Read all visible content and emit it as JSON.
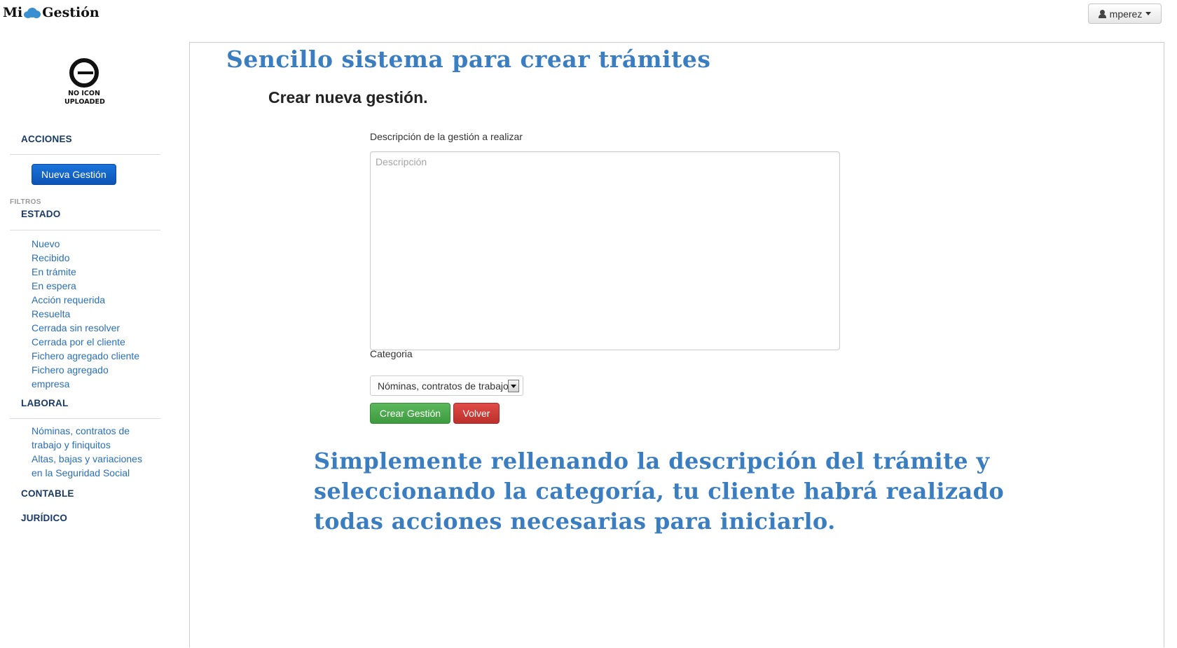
{
  "header": {
    "brand_left": "Mi",
    "brand_right": "Gestión",
    "user_label": "mperez"
  },
  "sidebar": {
    "logo_line1": "NO ICON",
    "logo_line2": "UPLOADED",
    "acciones_title": "ACCIONES",
    "nueva_gestion": "Nueva Gestión",
    "filtros_title": "FILTROS",
    "estado_title": "ESTADO",
    "estado_items": [
      "Nuevo",
      "Recibido",
      "En trámite",
      "En espera",
      "Acción requerida",
      "Resuelta",
      "Cerrada sin resolver",
      "Cerrada por el cliente",
      "Fichero agregado cliente",
      "Fichero agregado",
      "empresa"
    ],
    "laboral_title": "LABORAL",
    "laboral_items": [
      "Nóminas, contratos de",
      "trabajo y finiquitos",
      "Altas, bajas y variaciones",
      "en la Seguridad Social"
    ],
    "contable_title": "CONTABLE",
    "juridico_title": "JURÍDICO"
  },
  "main": {
    "headline": "Sencillo sistema para crear trámites",
    "subtitle": "Crear nueva gestión.",
    "description_label": "Descripción de la gestión a realizar",
    "description_placeholder": "Descripción",
    "category_label": "Categoria",
    "category_value": "Nóminas, contratos de trabajo y finiquitos",
    "create_button": "Crear Gestión",
    "back_button": "Volver",
    "callout": "Simplemente rellenando la descripción del trámite y seleccionando la categoría, tu cliente habrá realizado todas acciones necesarias para iniciarlo."
  },
  "colors": {
    "accent_blue": "#3a7ec1",
    "primary_button": "#0d54b5",
    "success_button": "#4cae4c",
    "danger_button": "#d43f3a",
    "link": "#2a6fb8"
  }
}
